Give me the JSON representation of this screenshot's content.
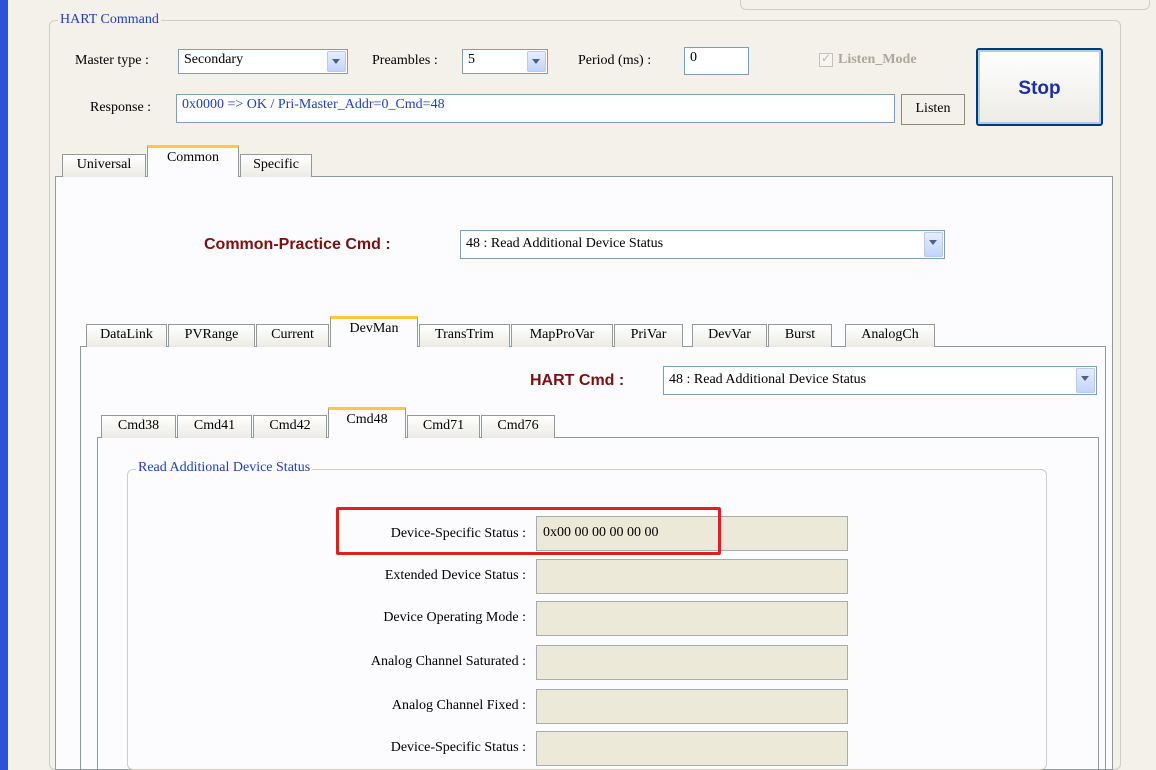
{
  "hart_group": {
    "title": "HART Command"
  },
  "master_type": {
    "label": "Master type :",
    "value": "Secondary"
  },
  "preambles": {
    "label": "Preambles :",
    "value": "5"
  },
  "period": {
    "label": "Period (ms) :",
    "value": "0"
  },
  "listen_mode": {
    "label": "Listen_Mode",
    "checked": true,
    "enabled": false
  },
  "response": {
    "label": "Response :",
    "value": "0x0000 => OK / Pri-Master_Addr=0_Cmd=48"
  },
  "listen_button": "Listen",
  "stop_button": "Stop",
  "main_tabs": [
    "Universal",
    "Common",
    "Specific"
  ],
  "main_tab_active": "Common",
  "common_cmd": {
    "label": "Common-Practice Cmd :",
    "value": "48 : Read Additional Device Status"
  },
  "sub_tabs": [
    "DataLink",
    "PVRange",
    "Current",
    "DevMan",
    "TransTrim",
    "MapProVar",
    "PriVar",
    "DevVar",
    "Burst",
    "AnalogCh"
  ],
  "sub_tab_active": "DevMan",
  "hart_cmd": {
    "label": "HART Cmd :",
    "value": "48 : Read Additional Device Status"
  },
  "cmd_tabs": [
    "Cmd38",
    "Cmd41",
    "Cmd42",
    "Cmd48",
    "Cmd71",
    "Cmd76"
  ],
  "cmd_tab_active": "Cmd48",
  "status_group": {
    "title": "Read Additional Device Status"
  },
  "fields": [
    {
      "label": "Device-Specific Status :",
      "value": "0x00 00 00 00 00 00",
      "highlighted": true
    },
    {
      "label": "Extended Device Status :",
      "value": ""
    },
    {
      "label": "Device Operating Mode :",
      "value": ""
    },
    {
      "label": "Analog Channel Saturated :",
      "value": ""
    },
    {
      "label": "Analog Channel Fixed :",
      "value": ""
    },
    {
      "label": "Device-Specific Status :",
      "value": ""
    }
  ],
  "colors": {
    "accent_blue": "#2a54d8",
    "label_red": "#7b1010",
    "highlight_red": "#e02020",
    "tab_accent": "#ffc83c"
  }
}
